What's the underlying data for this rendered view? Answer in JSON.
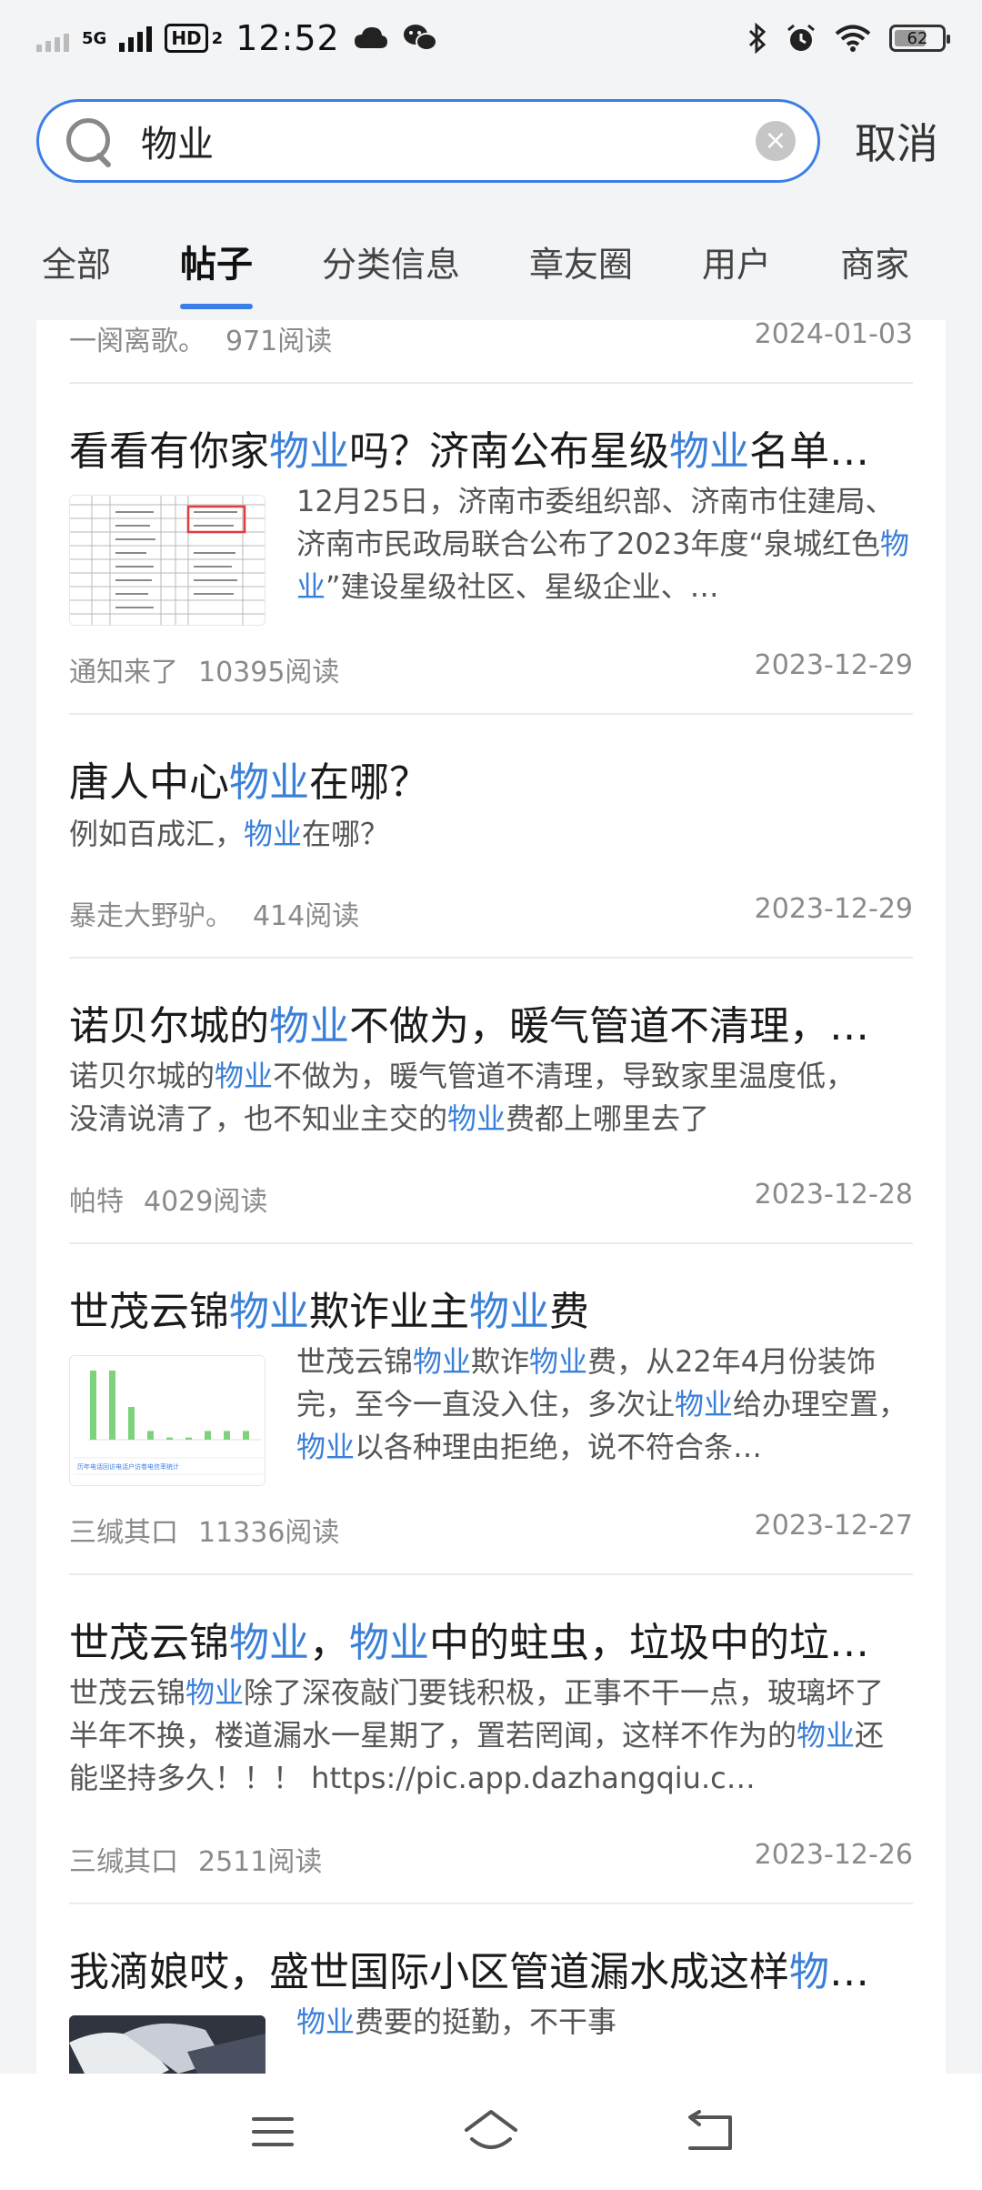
{
  "status_bar": {
    "network": "5G",
    "hd": "HD",
    "sim": "2",
    "time": "12:52",
    "battery": "62"
  },
  "search": {
    "query": "物业",
    "placeholder": "",
    "cancel_label": "取消"
  },
  "tabs": [
    {
      "label": "全部",
      "active": false
    },
    {
      "label": "帖子",
      "active": true
    },
    {
      "label": "分类信息",
      "active": false
    },
    {
      "label": "章友圈",
      "active": false
    },
    {
      "label": "用户",
      "active": false
    },
    {
      "label": "商家",
      "active": false
    }
  ],
  "posts": [
    {
      "author": "一阕离歌。",
      "reads": "971阅读",
      "date": "2024-01-03"
    },
    {
      "title_parts": [
        "看看有你家",
        "物业",
        "吗？济南公布星级",
        "物业",
        "名单…"
      ],
      "excerpt_parts": [
        "12月25日，济南市委组织部、济南市住建局、济南市民政局联合公布了2023年度“泉城红色",
        "物业",
        "”建设星级社区、星级企业、…"
      ],
      "author": "通知来了",
      "reads": "10395阅读",
      "date": "2023-12-29"
    },
    {
      "title_parts": [
        "唐人中心",
        "物业",
        "在哪？"
      ],
      "excerpt_parts": [
        "例如百成汇，",
        "物业",
        "在哪？"
      ],
      "author": "暴走大野驴。",
      "reads": "414阅读",
      "date": "2023-12-29"
    },
    {
      "title_parts": [
        "诺贝尔城的",
        "物业",
        "不做为，暖气管道不清理，…"
      ],
      "excerpt_parts": [
        "诺贝尔城的",
        "物业",
        "不做为，暖气管道不清理，导致家里温度低，没清说清了，也不知业主交的",
        "物业",
        "费都上哪里去了"
      ],
      "author": "帕特",
      "reads": "4029阅读",
      "date": "2023-12-28"
    },
    {
      "title_parts": [
        "世茂云锦",
        "物业",
        "欺诈业主",
        "物业",
        "费"
      ],
      "excerpt_parts": [
        "世茂云锦",
        "物业",
        "欺诈",
        "物业",
        "费，从22年4月份装饰完，至今一直没入住，多次让",
        "物业",
        "给办理空置，",
        "物业",
        "以各种理由拒绝，说不符合条…"
      ],
      "author": "三缄其口",
      "reads": "11336阅读",
      "date": "2023-12-27"
    },
    {
      "title_parts": [
        "世茂云锦",
        "物业",
        "，",
        "物业",
        "中的蛀虫，垃圾中的垃…"
      ],
      "excerpt_parts": [
        "世茂云锦",
        "物业",
        "除了深夜敲门要钱积极，正事不干一点，玻璃坏了半年不换，楼道漏水一星期了，置若罔闻，这样不作为的",
        "物业",
        "还能坚持多久！！！ https://pic.app.dazhangqiu.c…"
      ],
      "author": "三缄其口",
      "reads": "2511阅读",
      "date": "2023-12-26"
    },
    {
      "title_parts": [
        "我滴娘哎，盛世国际小区管道漏水成这样",
        "物",
        "…"
      ],
      "excerpt_parts": [
        "物业",
        "费要的挺勤，不干事"
      ]
    }
  ],
  "thumbnail_chart": {
    "footer_text": "历年电话回访电话户访卷电信率统计",
    "values": [
      95,
      95,
      45,
      12,
      3,
      3,
      12,
      12,
      12
    ]
  },
  "colors": {
    "accent": "#3b7ee8",
    "highlight": "#3a7fd8",
    "chart_green": "#7ed37a"
  },
  "nav_icons": [
    "menu-icon",
    "home-icon",
    "back-icon"
  ]
}
